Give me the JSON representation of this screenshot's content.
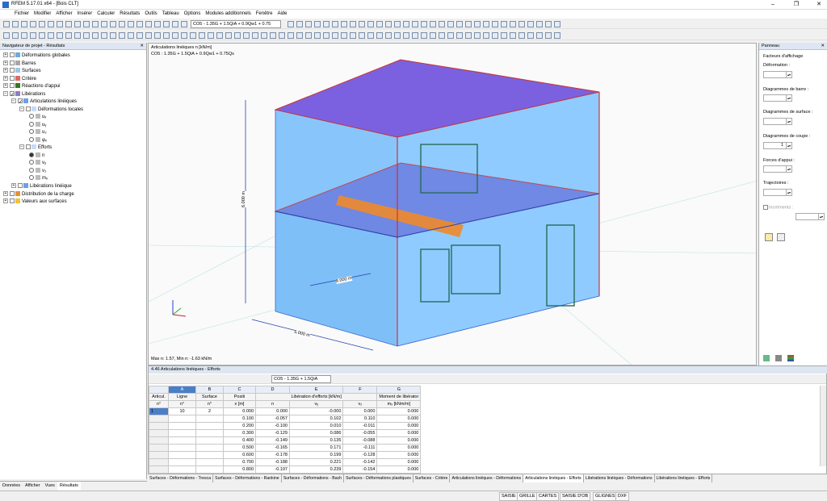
{
  "window": {
    "title": "RFEM 5.17.01 x64 - [Bois CLT]"
  },
  "menu": [
    "Fichier",
    "Modifier",
    "Afficher",
    "Insérer",
    "Calculer",
    "Résultats",
    "Outils",
    "Tableau",
    "Options",
    "Modules additionnels",
    "Fenêtre",
    "Aide"
  ],
  "toolbar": {
    "combo_main": "CO5 - 1.35G + 1.5QiA + 0.9Qw1 + 0.75"
  },
  "navigator": {
    "title": "Navigateur de projet - Résultats",
    "items": [
      "Déformations globales",
      "Barres",
      "Surfaces",
      "Critère",
      "Réactions d'appui",
      "Libérations",
      "Articulations linéiques",
      "Déformations locales",
      "uₓ",
      "uᵧ",
      "u₂",
      "φₓ",
      "Efforts",
      "n",
      "vᵧ",
      "v₂",
      "mₓ",
      "Libérations linéique",
      "Distribution de la charge",
      "Valeurs aux surfaces"
    ],
    "tabs": [
      "Données",
      "Afficher",
      "Vues",
      "Résultats"
    ]
  },
  "view": {
    "header_line1": "Articulations linéiques n [kN/m]",
    "header_line2": "CO5 : 1.35G + 1.5QiA + 0.9Qw1 + 0.75Qs",
    "footer": "Max n: 1.57, Min n: -1.63 kN/m",
    "dim_height": "6.000 m",
    "dim_depth": "5.000 m",
    "dim_inner": "8.000 m"
  },
  "panel": {
    "title": "Panneau",
    "factors": "Facteurs d'affichage",
    "labels": [
      "Déformation :",
      "Diagrammes de barre :",
      "Diagrammes de surface :",
      "Diagrammes de coupe :",
      "Forces d'appui :",
      "Trajectoires :"
    ],
    "section_value": "1",
    "increments": "Incréments :"
  },
  "table": {
    "title": "4.46 Articulations linéiques - Efforts",
    "combo": "CO5 - 1.35G + 1.5QiA",
    "col_letters": [
      "A",
      "B",
      "C",
      "D",
      "E",
      "F",
      "G"
    ],
    "headers1": [
      "Articul.",
      "Ligne",
      "Surface",
      "Positi",
      "",
      "Libération d'efforts [kN/m]",
      "",
      "Moment de libérator"
    ],
    "headers2": [
      "n°",
      "n°",
      "n°",
      "x [m]",
      "n",
      "vᵧ",
      "v₂",
      "mₓ [kNm/m]"
    ],
    "rows": [
      [
        "1",
        "10",
        "2",
        "0.000",
        "0.000",
        "-0.000",
        "0.000",
        "0.000"
      ],
      [
        "",
        "",
        "",
        "0.100",
        "-0.057",
        "0.102",
        "0.110",
        "0.000"
      ],
      [
        "",
        "",
        "",
        "0.200",
        "-0.100",
        "0.010",
        "-0.011",
        "0.000"
      ],
      [
        "",
        "",
        "",
        "0.300",
        "-0.129",
        "0.086",
        "-0.055",
        "0.000"
      ],
      [
        "",
        "",
        "",
        "0.400",
        "-0.149",
        "0.135",
        "-0.088",
        "0.000"
      ],
      [
        "",
        "",
        "",
        "0.500",
        "-0.165",
        "0.171",
        "-0.111",
        "0.000"
      ],
      [
        "",
        "",
        "",
        "0.600",
        "-0.178",
        "0.199",
        "-0.128",
        "0.000"
      ],
      [
        "",
        "",
        "",
        "0.700",
        "-0.188",
        "0.221",
        "-0.142",
        "0.000"
      ],
      [
        "",
        "",
        "",
        "0.800",
        "-0.197",
        "0.239",
        "-0.154",
        "0.000"
      ]
    ],
    "sheets": [
      "Surfaces - Déformations - Tresca",
      "Surfaces - Déformations - Rankine",
      "Surfaces - Déformations - Bach",
      "Surfaces - Déformations plastiques",
      "Surfaces - Critère",
      "Articulations linéiques - Déformations",
      "Articulations linéiques - Efforts",
      "Libérations linéiques - Déformations",
      "Libérations linéiques - Efforts"
    ]
  },
  "status": [
    "SAISIE",
    "GRILLE",
    "CARTES",
    "SAISIE D'OB",
    "GLIGNES",
    "DXF"
  ]
}
